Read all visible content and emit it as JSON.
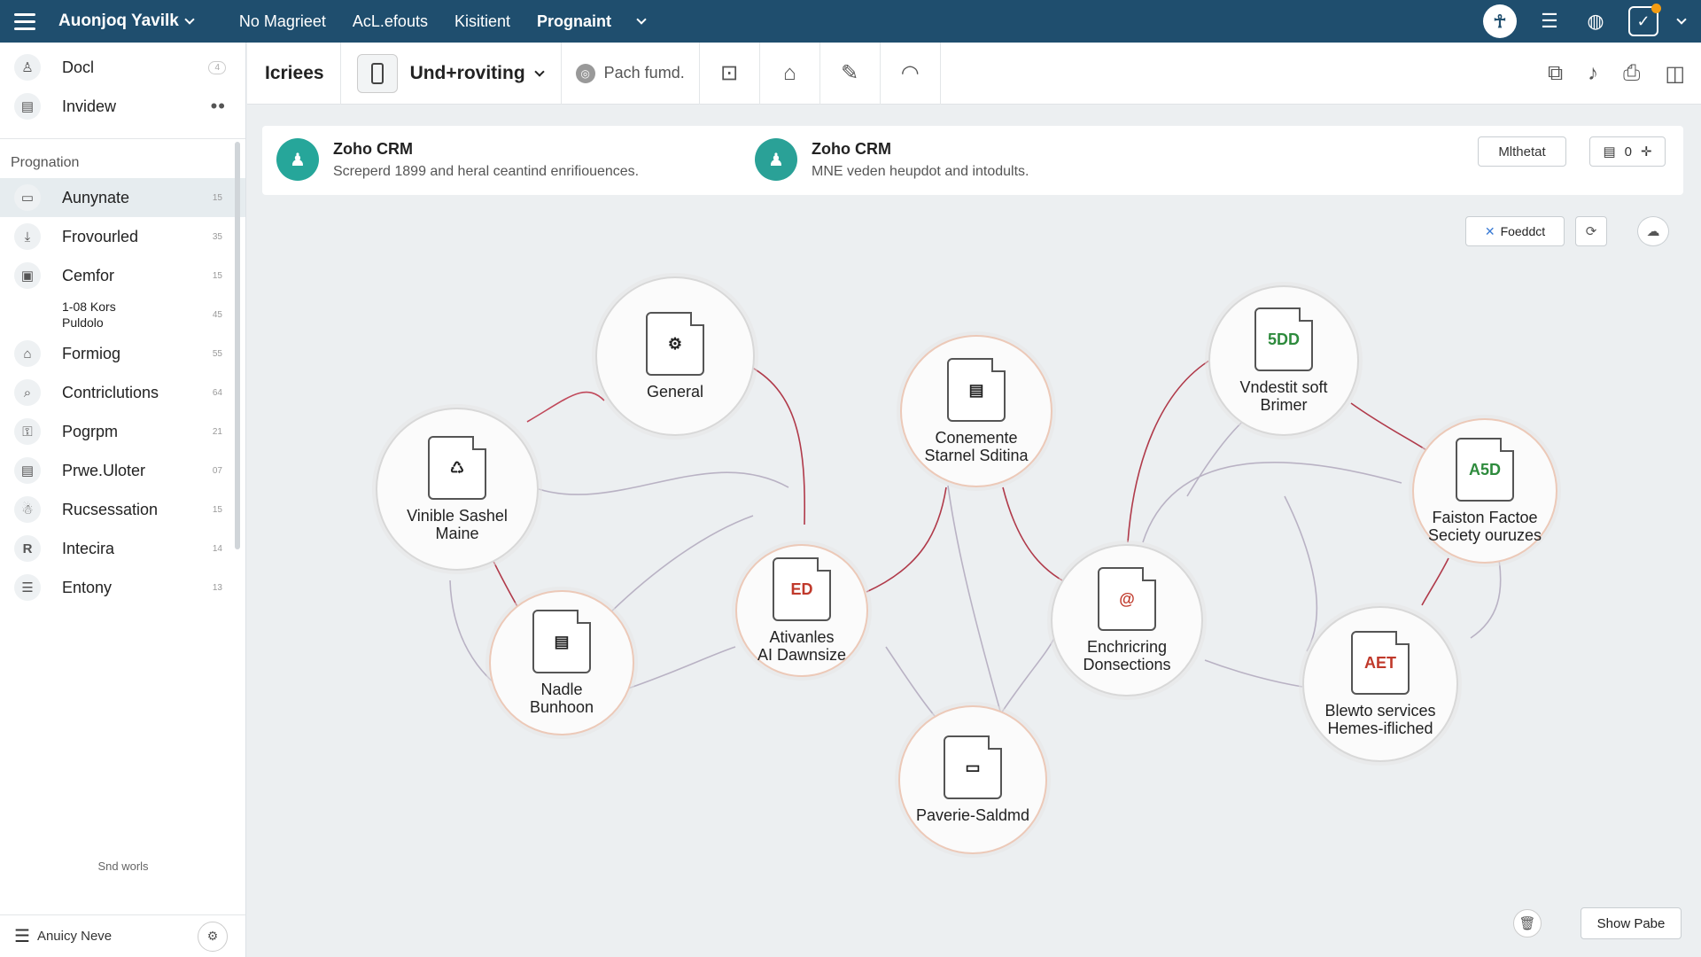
{
  "topbar": {
    "brand": "Auonjoq Yavilk",
    "nav": [
      "No Magrieet",
      "AcL.efouts",
      "Kisitient",
      "Prognaint"
    ]
  },
  "sidebar": {
    "top_items": [
      {
        "label": "Docl",
        "badge": "4"
      },
      {
        "label": "Invidew"
      }
    ],
    "section": "Prognation",
    "items": [
      {
        "label": "Aunynate",
        "num": "15",
        "icon": "inbox-icon"
      },
      {
        "label": "Frovourled",
        "num": "35",
        "icon": "download-icon"
      },
      {
        "label": "Cemfor",
        "num": "15",
        "icon": "image-icon"
      },
      {
        "label": "1-08 Kors\nPuldolo",
        "num": "45",
        "icon": ""
      },
      {
        "label": "Formiog",
        "num": "55",
        "icon": "home-icon"
      },
      {
        "label": "Contriclutions",
        "num": "64",
        "icon": "search-icon"
      },
      {
        "label": "Pogrpm",
        "num": "21",
        "icon": "lock-icon"
      },
      {
        "label": "Prwe.Uloter",
        "num": "07",
        "icon": "list-icon"
      },
      {
        "label": "Rucsessation",
        "num": "15",
        "icon": "person-icon"
      },
      {
        "label": "Intecira",
        "num": "14",
        "icon": "r-icon"
      },
      {
        "label": "Entony",
        "num": "13",
        "icon": "doc-icon"
      }
    ],
    "footer_note": "Snd worls",
    "footer": "Anuicy Neve"
  },
  "toolbar": {
    "title": "Icriees",
    "dropdown": "Und+roviting",
    "search": "Pach fumd."
  },
  "info": {
    "cards": [
      {
        "title": "Zoho CRM",
        "desc": "Screperd 1899 and heral ceantind enrifiouences."
      },
      {
        "title": "Zoho CRM",
        "desc": "MNE veden heupdot and intodults."
      }
    ],
    "button": "Mlthetat",
    "count": "0"
  },
  "canvas": {
    "feed_button": "Foeddct",
    "show_button": "Show Pabe"
  },
  "nodes": [
    {
      "label": "General",
      "glyph": "⚙",
      "variant": ""
    },
    {
      "label": "Vinible Sashel\nMaine",
      "glyph": "♺",
      "variant": ""
    },
    {
      "label": "Nadle\nBunhoon",
      "glyph": "▤",
      "variant": ""
    },
    {
      "label": "Ativanles\nAI Dawnsize",
      "glyph": "ED",
      "variant": "red"
    },
    {
      "label": "Conemente\nStarnel Sditina",
      "glyph": "▤",
      "variant": ""
    },
    {
      "label": "Paverie-Saldmd",
      "glyph": "▭",
      "variant": ""
    },
    {
      "label": "Vndestit soft\nBrimer",
      "glyph": "5DD",
      "variant": "green"
    },
    {
      "label": "Enchricring\nDonsections",
      "glyph": "@",
      "variant": "red"
    },
    {
      "label": "Faiston Factoe\nSeciety ouruzes",
      "glyph": "A5D",
      "variant": "green"
    },
    {
      "label": "Blewto services\nHemes-ifliched",
      "glyph": "AET",
      "variant": "red"
    }
  ]
}
